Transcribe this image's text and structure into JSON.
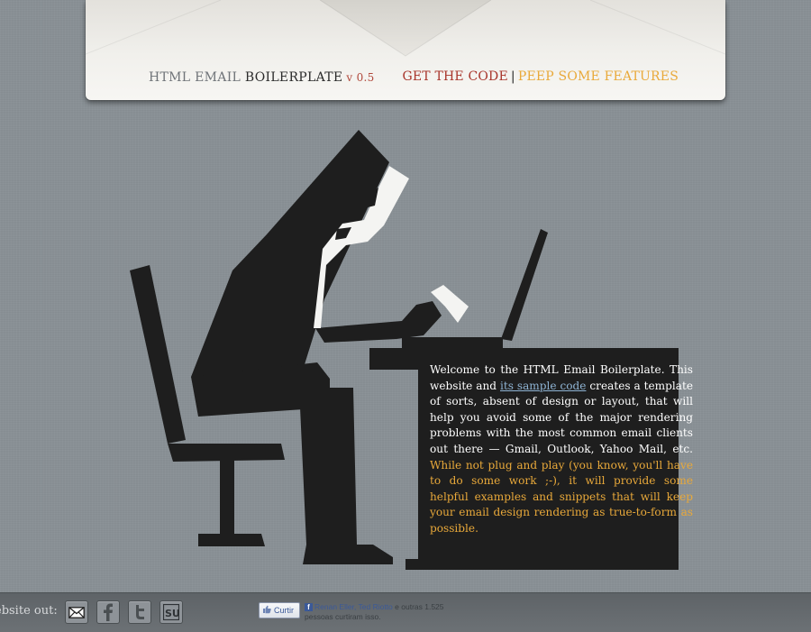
{
  "header": {
    "logo_part1": "HTML EMAIL ",
    "logo_part2": "BOILERPLATE",
    "version": "v 0.5",
    "nav_get_code": "GET THE CODE",
    "nav_separator": "|",
    "nav_features": "PEEP SOME FEATURES"
  },
  "intro": {
    "text_1": "Welcome to the HTML Email Boilerplate. This website and ",
    "link": "its sample code",
    "text_2": " creates a template of sorts, absent of design or layout, that will help you avoid some of the major rendering problems with the most common email clients out there — Gmail, Outlook, Yahoo Mail, etc. ",
    "highlight": "While not plug and play (you know, you'll have to do some work ;-), it will provide some helpful examples and snippets that will keep your email design rendering as true-to-form as possible."
  },
  "footer": {
    "check_label": "ebsite out:",
    "share_buttons": [
      {
        "icon": "email-icon"
      },
      {
        "icon": "facebook-icon"
      },
      {
        "icon": "twitter-icon"
      },
      {
        "icon": "stumbleupon-icon"
      }
    ],
    "like_label": "Curtir",
    "like_names": "Renan Eller, Ted Riotto",
    "like_text": " e outras 1.525 pessoas curtiram isso."
  },
  "colors": {
    "background": "#8a9196",
    "figure": "#1e1e1e",
    "link_red": "#a8352b",
    "accent_orange": "#e9a93a",
    "link_blue": "#8fb4d4"
  }
}
